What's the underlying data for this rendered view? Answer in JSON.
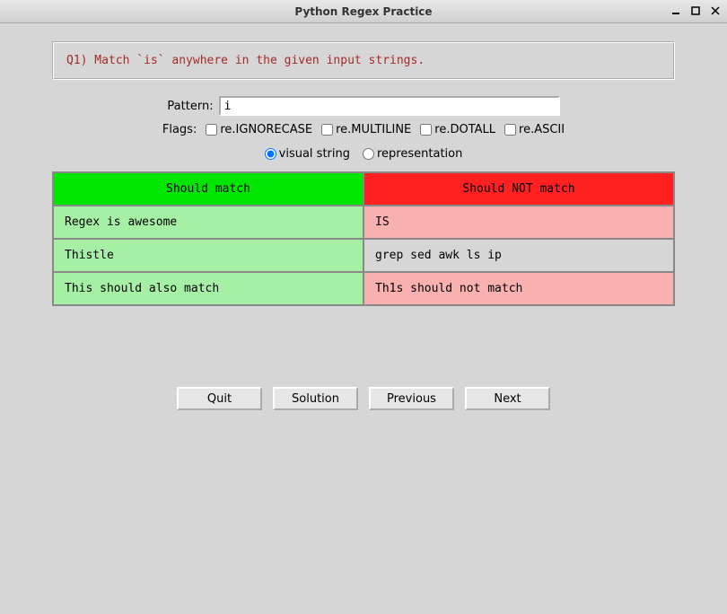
{
  "window": {
    "title": "Python Regex Practice"
  },
  "question": "Q1) Match `is` anywhere in the given input strings.",
  "pattern": {
    "label": "Pattern:",
    "value": "i"
  },
  "flags": {
    "label": "Flags:",
    "options": [
      "re.IGNORECASE",
      "re.MULTILINE",
      "re.DOTALL",
      "re.ASCII"
    ]
  },
  "view": {
    "options": [
      "visual string",
      "representation"
    ],
    "selected": "visual string"
  },
  "tableHeaders": {
    "match": "Should match",
    "nomatch": "Should NOT match"
  },
  "rows": [
    {
      "match": "Regex is awesome",
      "matchState": "match-ok",
      "nomatch": "IS",
      "nomatchState": "nomatch-ok"
    },
    {
      "match": "Thistle",
      "matchState": "match-ok",
      "nomatch": "grep sed awk ls ip",
      "nomatchState": "neutral"
    },
    {
      "match": "This should also match",
      "matchState": "match-ok",
      "nomatch": "Th1s should not match",
      "nomatchState": "nomatch-ok"
    }
  ],
  "buttons": {
    "quit": "Quit",
    "solution": "Solution",
    "previous": "Previous",
    "next": "Next"
  }
}
